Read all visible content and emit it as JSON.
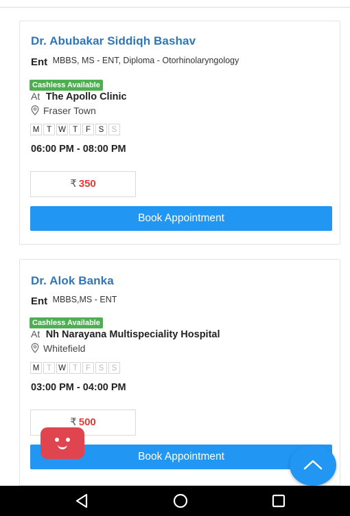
{
  "doctors": [
    {
      "name": "Dr. Abubakar Siddiqh Bashav",
      "specialty": "Ent",
      "qualifications": "MBBS, MS - ENT, Diploma - Otorhinolaryngology",
      "cashless_label": "Cashless Available",
      "at_label": "At",
      "clinic": "The Apollo Clinic",
      "location": "Fraser Town",
      "days": [
        {
          "label": "M",
          "available": true
        },
        {
          "label": "T",
          "available": true
        },
        {
          "label": "W",
          "available": true
        },
        {
          "label": "T",
          "available": true
        },
        {
          "label": "F",
          "available": true
        },
        {
          "label": "S",
          "available": true
        },
        {
          "label": "S",
          "available": false
        }
      ],
      "time": "06:00 PM - 08:00 PM",
      "currency": "₹",
      "fee": "350",
      "book_label": "Book Appointment"
    },
    {
      "name": "Dr. Alok Banka",
      "specialty": "Ent",
      "qualifications": "MBBS,MS - ENT",
      "cashless_label": "Cashless Available",
      "at_label": "At",
      "clinic": "Nh Narayana Multispeciality Hospital",
      "location": "Whitefield",
      "days": [
        {
          "label": "M",
          "available": true
        },
        {
          "label": "T",
          "available": false
        },
        {
          "label": "W",
          "available": true
        },
        {
          "label": "T",
          "available": false
        },
        {
          "label": "F",
          "available": false
        },
        {
          "label": "S",
          "available": false
        },
        {
          "label": "S",
          "available": false
        }
      ],
      "time": "03:00 PM - 04:00 PM",
      "currency": "₹",
      "fee": "500",
      "book_label": "Book Appointment"
    }
  ],
  "colors": {
    "doctor_name": "#2c76b9",
    "cashless_badge": "#4caf50",
    "fee": "#e53935",
    "book_button": "#2196f3",
    "chat_button": "#e0454f",
    "scroll_top_button": "#2196f3"
  },
  "icons": {
    "location": "map-pin-icon",
    "chat": "chat-bot-smiley-icon",
    "scroll_top": "chevron-up-icon",
    "nav_back": "triangle-back-icon",
    "nav_home": "circle-home-icon",
    "nav_recents": "square-recents-icon"
  }
}
